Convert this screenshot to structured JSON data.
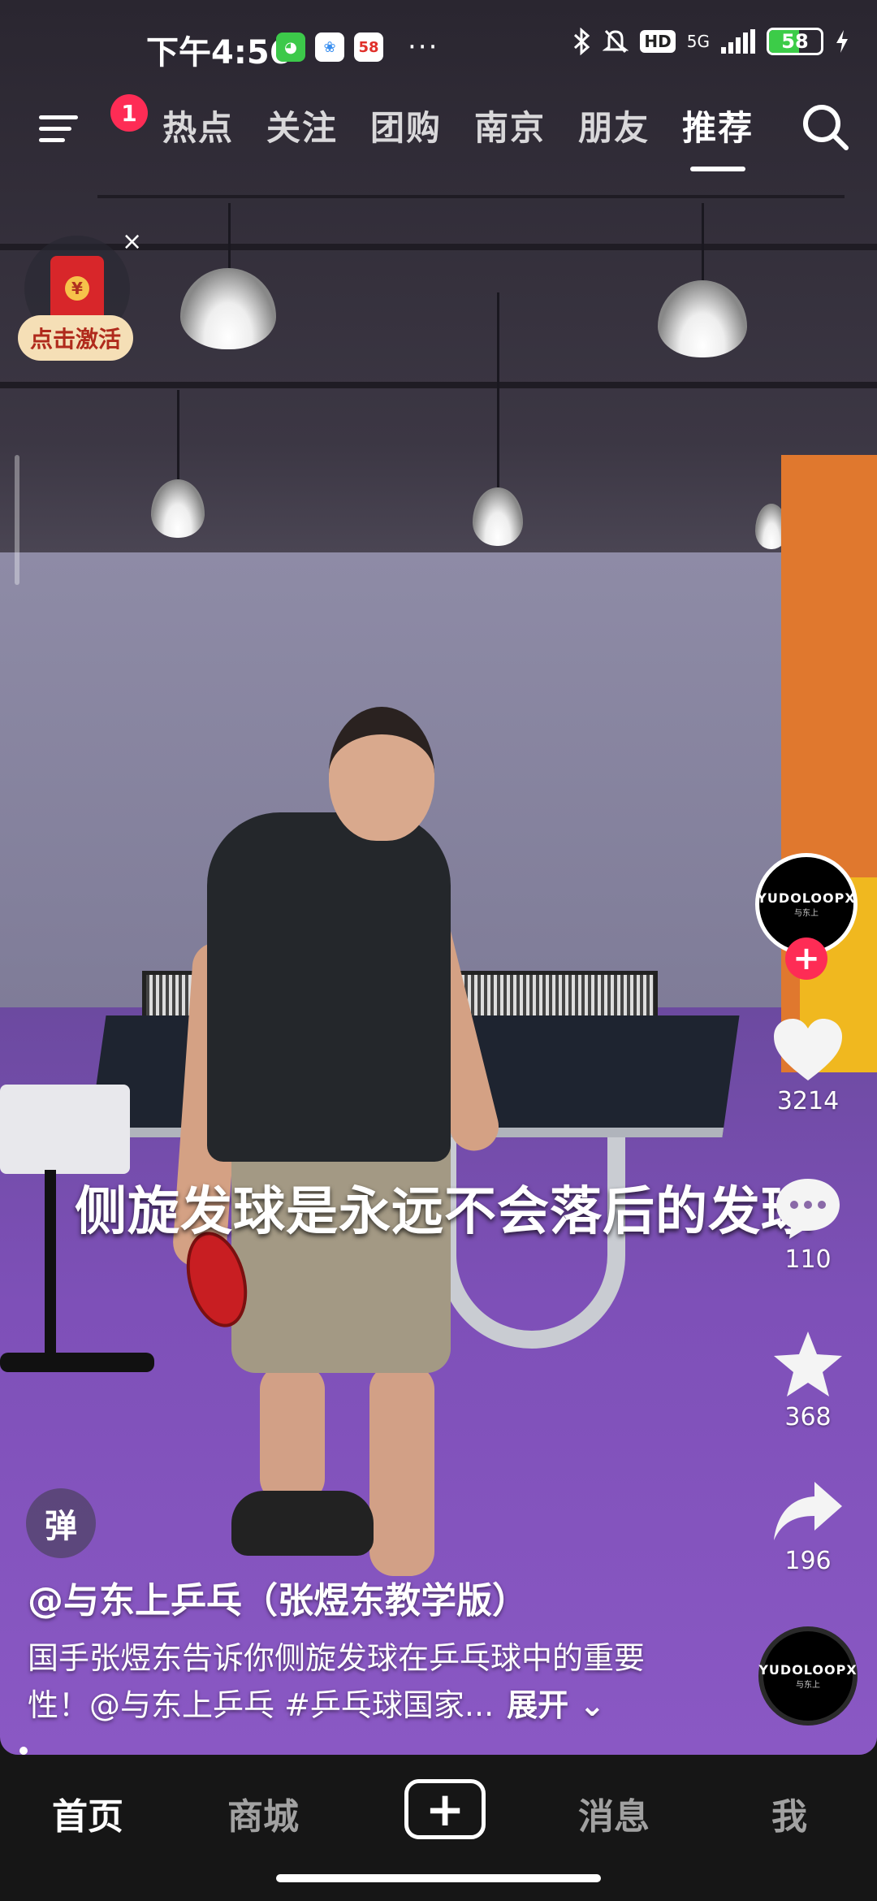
{
  "status_bar": {
    "time": "下午4:56",
    "app_58": "58",
    "more": "···",
    "hd": "HD",
    "network": "5G",
    "battery": "58",
    "battery_level": 0.58
  },
  "top_nav": {
    "badge_count": "1",
    "tabs": [
      {
        "label": "热点"
      },
      {
        "label": "关注"
      },
      {
        "label": "团购"
      },
      {
        "label": "南京"
      },
      {
        "label": "朋友"
      },
      {
        "label": "推荐",
        "active": true
      }
    ]
  },
  "red_packet": {
    "close": "×",
    "label": "点击激活",
    "coin": "¥"
  },
  "video": {
    "subtitle": "侧旋发球是永远不会落后的发球"
  },
  "creator_avatar": {
    "text": "YUDOLOOPX",
    "sub": "与东上"
  },
  "actions": {
    "likes": "3214",
    "comments": "110",
    "favorites": "368",
    "shares": "196"
  },
  "danmu_label": "弹",
  "caption": {
    "author": "@与东上乒乓（张煜东教学版）",
    "description": "国手张煜东告诉你侧旋发球在乒乓球中的重要性！@与东上乒乓 #乒乓球国家...",
    "expand": "展开"
  },
  "bottom_bar": {
    "tabs": [
      {
        "label": "首页",
        "active": true
      },
      {
        "label": "商城"
      },
      {
        "label": "消息"
      },
      {
        "label": "我"
      }
    ],
    "plus": "+"
  },
  "colors": {
    "accent": "#fe2c55",
    "background": "#161616",
    "floor": "#7e50b8"
  }
}
